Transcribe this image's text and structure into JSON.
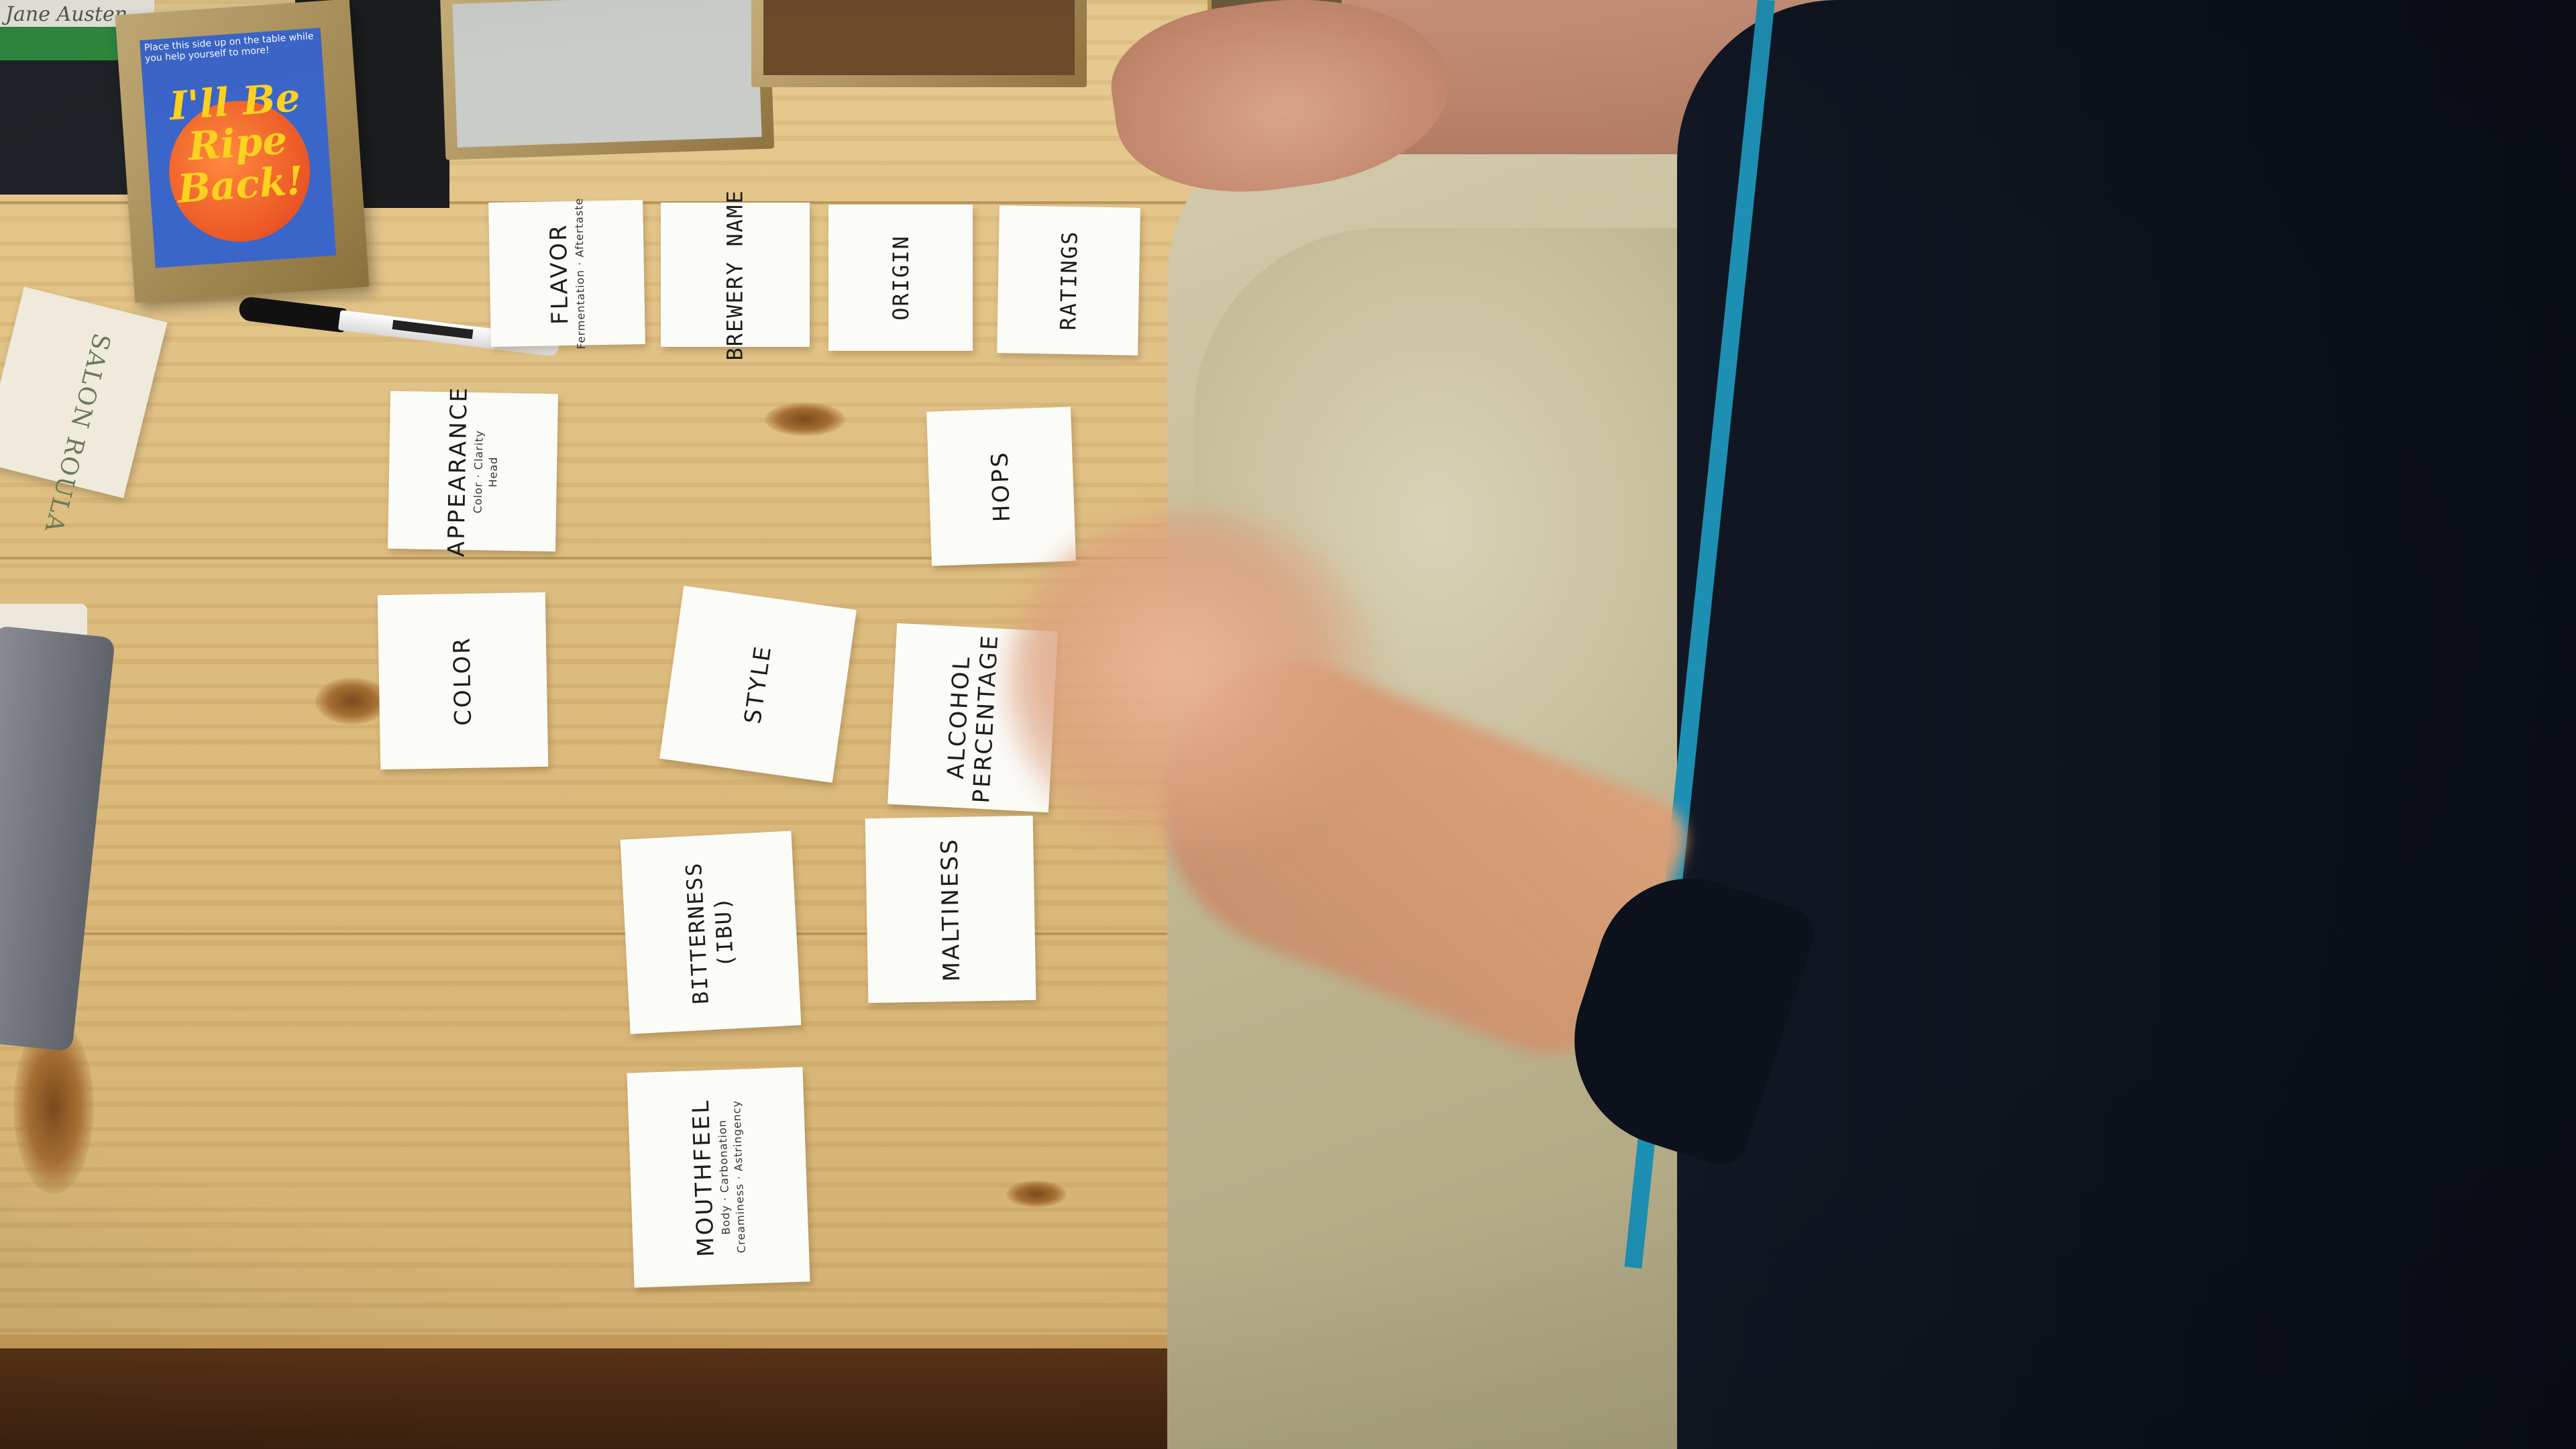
{
  "book": {
    "title": "Jane Austen"
  },
  "mini_poster": {
    "note": "Place this side up on the table while you help yourself to more!",
    "slogan": "I'll Be Ripe Back!"
  },
  "business_card": {
    "name": "SALON ROULA"
  },
  "cards": [
    {
      "title": "FLAVOR",
      "subtitle": "Fermentation · Aftertaste",
      "style": "print"
    },
    {
      "title": "BREWERY NAME",
      "subtitle": "",
      "style": "hand"
    },
    {
      "title": "ORIGIN",
      "subtitle": "",
      "style": "hand"
    },
    {
      "title": "RATINGS",
      "subtitle": "",
      "style": "hand"
    },
    {
      "title": "APPEARANCE",
      "subtitle": "Color · Clarity",
      "subtitle2": "Head",
      "style": "print"
    },
    {
      "title": "HOPS",
      "subtitle": "",
      "style": "print"
    },
    {
      "title": "COLOR",
      "subtitle": "",
      "style": "print"
    },
    {
      "title": "STYLE",
      "subtitle": "",
      "style": "print"
    },
    {
      "title": "ALCOHOL",
      "subtitle": "",
      "title2": "PERCENTAGE",
      "style": "print"
    },
    {
      "title": "BITTERNESS",
      "title2": "(IBU)",
      "subtitle": "",
      "style": "hand"
    },
    {
      "title": "MALTINESS",
      "subtitle": "",
      "style": "print"
    },
    {
      "title": "MOUTHFEEL",
      "subtitle": "Body · Carbonation",
      "subtitle2": "Creaminess · Astringency",
      "style": "print"
    }
  ]
}
